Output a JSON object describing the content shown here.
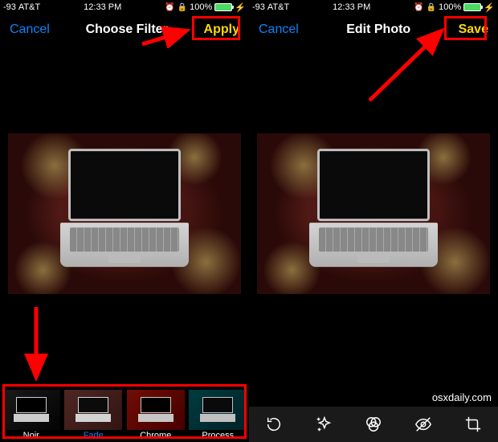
{
  "status": {
    "signal": "-93",
    "carrier": "AT&T",
    "time": "12:33 PM",
    "battery_pct": "100%"
  },
  "left": {
    "cancel": "Cancel",
    "title": "Choose Filter",
    "action": "Apply",
    "filters": [
      {
        "name": "Noir"
      },
      {
        "name": "Fade"
      },
      {
        "name": "Chrome"
      },
      {
        "name": "Process"
      }
    ]
  },
  "right": {
    "cancel": "Cancel",
    "title": "Edit Photo",
    "action": "Save"
  },
  "watermark": "osxdaily.com"
}
